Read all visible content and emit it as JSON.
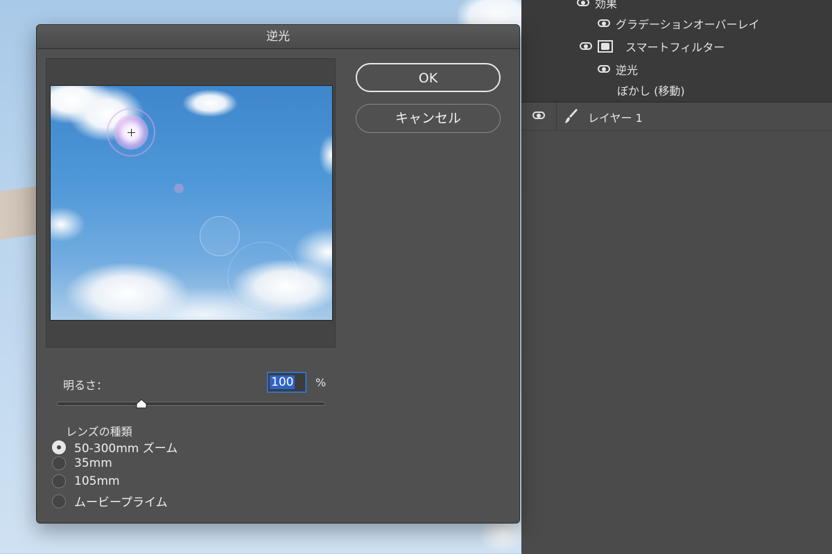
{
  "dialog": {
    "title": "逆光",
    "ok_label": "OK",
    "cancel_label": "キャンセル",
    "brightness_label": "明るさ：",
    "brightness_value": "100",
    "brightness_unit": "%",
    "brightness_slider_value": 100,
    "lens_group_title": "レンズの種類",
    "lens_options": [
      {
        "label": "50-300mm ズーム",
        "selected": true
      },
      {
        "label": "35mm",
        "selected": false
      },
      {
        "label": "105mm",
        "selected": false
      },
      {
        "label": "ムービープライム",
        "selected": false
      }
    ]
  },
  "layers": {
    "effects_label": "効果",
    "gradient_overlay_label": "グラデーションオーバーレイ",
    "smart_filter_label": "スマートフィルター",
    "backlight_filter_label": "逆光",
    "blur_filter_label": "ぼかし (移動)",
    "layer1_label": "レイヤー 1"
  },
  "colors": {
    "dialog_bg": "#505050",
    "panel_bg": "#3a3a3a",
    "selection_blue": "#2e63c7",
    "focus_border": "#3d7fd8"
  }
}
